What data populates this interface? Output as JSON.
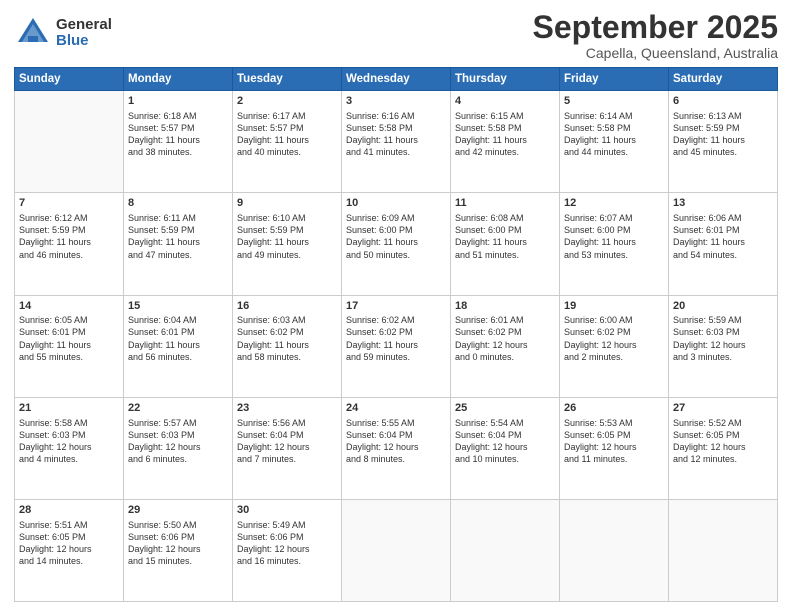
{
  "logo": {
    "general": "General",
    "blue": "Blue"
  },
  "title": {
    "month": "September 2025",
    "location": "Capella, Queensland, Australia"
  },
  "calendar": {
    "headers": [
      "Sunday",
      "Monday",
      "Tuesday",
      "Wednesday",
      "Thursday",
      "Friday",
      "Saturday"
    ],
    "weeks": [
      [
        {
          "day": "",
          "info": ""
        },
        {
          "day": "1",
          "info": "Sunrise: 6:18 AM\nSunset: 5:57 PM\nDaylight: 11 hours\nand 38 minutes."
        },
        {
          "day": "2",
          "info": "Sunrise: 6:17 AM\nSunset: 5:57 PM\nDaylight: 11 hours\nand 40 minutes."
        },
        {
          "day": "3",
          "info": "Sunrise: 6:16 AM\nSunset: 5:58 PM\nDaylight: 11 hours\nand 41 minutes."
        },
        {
          "day": "4",
          "info": "Sunrise: 6:15 AM\nSunset: 5:58 PM\nDaylight: 11 hours\nand 42 minutes."
        },
        {
          "day": "5",
          "info": "Sunrise: 6:14 AM\nSunset: 5:58 PM\nDaylight: 11 hours\nand 44 minutes."
        },
        {
          "day": "6",
          "info": "Sunrise: 6:13 AM\nSunset: 5:59 PM\nDaylight: 11 hours\nand 45 minutes."
        }
      ],
      [
        {
          "day": "7",
          "info": "Sunrise: 6:12 AM\nSunset: 5:59 PM\nDaylight: 11 hours\nand 46 minutes."
        },
        {
          "day": "8",
          "info": "Sunrise: 6:11 AM\nSunset: 5:59 PM\nDaylight: 11 hours\nand 47 minutes."
        },
        {
          "day": "9",
          "info": "Sunrise: 6:10 AM\nSunset: 5:59 PM\nDaylight: 11 hours\nand 49 minutes."
        },
        {
          "day": "10",
          "info": "Sunrise: 6:09 AM\nSunset: 6:00 PM\nDaylight: 11 hours\nand 50 minutes."
        },
        {
          "day": "11",
          "info": "Sunrise: 6:08 AM\nSunset: 6:00 PM\nDaylight: 11 hours\nand 51 minutes."
        },
        {
          "day": "12",
          "info": "Sunrise: 6:07 AM\nSunset: 6:00 PM\nDaylight: 11 hours\nand 53 minutes."
        },
        {
          "day": "13",
          "info": "Sunrise: 6:06 AM\nSunset: 6:01 PM\nDaylight: 11 hours\nand 54 minutes."
        }
      ],
      [
        {
          "day": "14",
          "info": "Sunrise: 6:05 AM\nSunset: 6:01 PM\nDaylight: 11 hours\nand 55 minutes."
        },
        {
          "day": "15",
          "info": "Sunrise: 6:04 AM\nSunset: 6:01 PM\nDaylight: 11 hours\nand 56 minutes."
        },
        {
          "day": "16",
          "info": "Sunrise: 6:03 AM\nSunset: 6:02 PM\nDaylight: 11 hours\nand 58 minutes."
        },
        {
          "day": "17",
          "info": "Sunrise: 6:02 AM\nSunset: 6:02 PM\nDaylight: 11 hours\nand 59 minutes."
        },
        {
          "day": "18",
          "info": "Sunrise: 6:01 AM\nSunset: 6:02 PM\nDaylight: 12 hours\nand 0 minutes."
        },
        {
          "day": "19",
          "info": "Sunrise: 6:00 AM\nSunset: 6:02 PM\nDaylight: 12 hours\nand 2 minutes."
        },
        {
          "day": "20",
          "info": "Sunrise: 5:59 AM\nSunset: 6:03 PM\nDaylight: 12 hours\nand 3 minutes."
        }
      ],
      [
        {
          "day": "21",
          "info": "Sunrise: 5:58 AM\nSunset: 6:03 PM\nDaylight: 12 hours\nand 4 minutes."
        },
        {
          "day": "22",
          "info": "Sunrise: 5:57 AM\nSunset: 6:03 PM\nDaylight: 12 hours\nand 6 minutes."
        },
        {
          "day": "23",
          "info": "Sunrise: 5:56 AM\nSunset: 6:04 PM\nDaylight: 12 hours\nand 7 minutes."
        },
        {
          "day": "24",
          "info": "Sunrise: 5:55 AM\nSunset: 6:04 PM\nDaylight: 12 hours\nand 8 minutes."
        },
        {
          "day": "25",
          "info": "Sunrise: 5:54 AM\nSunset: 6:04 PM\nDaylight: 12 hours\nand 10 minutes."
        },
        {
          "day": "26",
          "info": "Sunrise: 5:53 AM\nSunset: 6:05 PM\nDaylight: 12 hours\nand 11 minutes."
        },
        {
          "day": "27",
          "info": "Sunrise: 5:52 AM\nSunset: 6:05 PM\nDaylight: 12 hours\nand 12 minutes."
        }
      ],
      [
        {
          "day": "28",
          "info": "Sunrise: 5:51 AM\nSunset: 6:05 PM\nDaylight: 12 hours\nand 14 minutes."
        },
        {
          "day": "29",
          "info": "Sunrise: 5:50 AM\nSunset: 6:06 PM\nDaylight: 12 hours\nand 15 minutes."
        },
        {
          "day": "30",
          "info": "Sunrise: 5:49 AM\nSunset: 6:06 PM\nDaylight: 12 hours\nand 16 minutes."
        },
        {
          "day": "",
          "info": ""
        },
        {
          "day": "",
          "info": ""
        },
        {
          "day": "",
          "info": ""
        },
        {
          "day": "",
          "info": ""
        }
      ]
    ]
  }
}
